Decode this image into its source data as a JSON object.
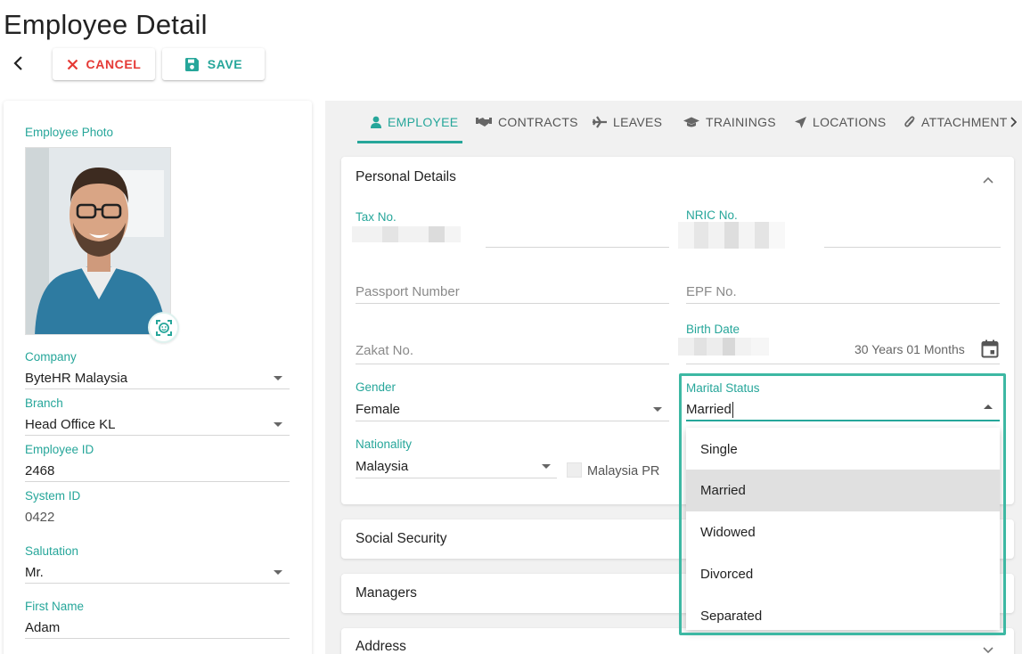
{
  "page": {
    "title": "Employee Detail"
  },
  "toolbar": {
    "cancel_label": "CANCEL",
    "save_label": "SAVE"
  },
  "colors": {
    "accent": "#26a69a",
    "danger": "#e53935",
    "highlight": "#3db8a3"
  },
  "left": {
    "photo_label": "Employee Photo",
    "company": {
      "label": "Company",
      "value": "ByteHR Malaysia"
    },
    "branch": {
      "label": "Branch",
      "value": "Head Office KL"
    },
    "employee_id": {
      "label": "Employee ID",
      "value": "2468"
    },
    "system_id": {
      "label": "System ID",
      "value": "0422"
    },
    "salutation": {
      "label": "Salutation",
      "value": "Mr."
    },
    "first_name": {
      "label": "First Name",
      "value": "Adam"
    }
  },
  "tabs": [
    {
      "label": "EMPLOYEE",
      "icon": "person-icon"
    },
    {
      "label": "CONTRACTS",
      "icon": "handshake-icon"
    },
    {
      "label": "LEAVES",
      "icon": "plane-icon"
    },
    {
      "label": "TRAININGS",
      "icon": "graduation-cap-icon"
    },
    {
      "label": "LOCATIONS",
      "icon": "location-arrow-icon"
    },
    {
      "label": "ATTACHMENT",
      "icon": "paperclip-icon"
    }
  ],
  "personal": {
    "title": "Personal Details",
    "tax_no": {
      "label": "Tax No."
    },
    "nric_no": {
      "label": "NRIC No."
    },
    "passport": {
      "placeholder": "Passport Number"
    },
    "epf": {
      "placeholder": "EPF No."
    },
    "zakat": {
      "placeholder": "Zakat No."
    },
    "birth_date": {
      "label": "Birth Date",
      "age": "30 Years 01 Months"
    },
    "gender": {
      "label": "Gender",
      "value": "Female"
    },
    "marital": {
      "label": "Marital Status",
      "value": "Married"
    },
    "nationality": {
      "label": "Nationality",
      "value": "Malaysia"
    },
    "malaysia_pr": {
      "label": "Malaysia PR"
    }
  },
  "marital_options": [
    "Single",
    "Married",
    "Widowed",
    "Divorced",
    "Separated"
  ],
  "sections": {
    "social_security": "Social Security",
    "managers": "Managers",
    "address": "Address"
  }
}
